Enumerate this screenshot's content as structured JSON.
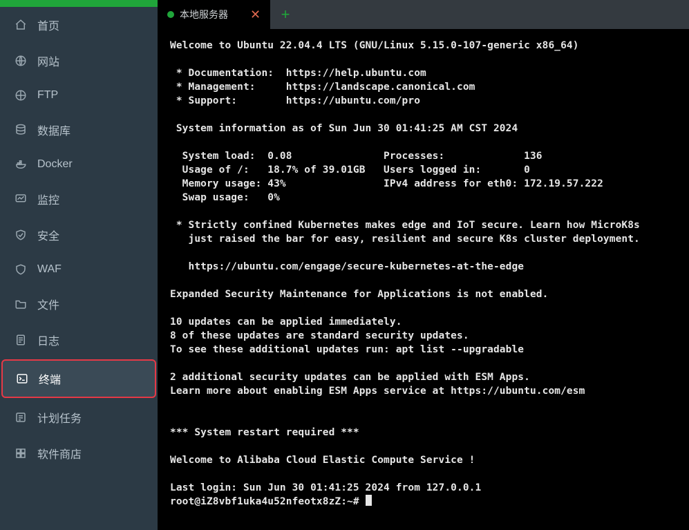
{
  "sidebar": {
    "items": [
      {
        "label": "首页",
        "name": "sidebar-item-home"
      },
      {
        "label": "网站",
        "name": "sidebar-item-site"
      },
      {
        "label": "FTP",
        "name": "sidebar-item-ftp"
      },
      {
        "label": "数据库",
        "name": "sidebar-item-database"
      },
      {
        "label": "Docker",
        "name": "sidebar-item-docker"
      },
      {
        "label": "监控",
        "name": "sidebar-item-monitor"
      },
      {
        "label": "安全",
        "name": "sidebar-item-security"
      },
      {
        "label": "WAF",
        "name": "sidebar-item-waf"
      },
      {
        "label": "文件",
        "name": "sidebar-item-files"
      },
      {
        "label": "日志",
        "name": "sidebar-item-logs"
      },
      {
        "label": "终端",
        "name": "sidebar-item-terminal"
      },
      {
        "label": "计划任务",
        "name": "sidebar-item-cron"
      },
      {
        "label": "软件商店",
        "name": "sidebar-item-softstore"
      }
    ]
  },
  "tabs": {
    "items": [
      {
        "label": "本地服务器"
      }
    ],
    "close_glyph": "✕",
    "add_glyph": "+"
  },
  "terminal": {
    "welcome": "Welcome to Ubuntu 22.04.4 LTS (GNU/Linux 5.15.0-107-generic x86_64)",
    "doc_line": " * Documentation:  https://help.ubuntu.com",
    "manage_line": " * Management:     https://landscape.canonical.com",
    "support_line": " * Support:        https://ubuntu.com/pro",
    "sysinfo_head": " System information as of Sun Jun 30 01:41:25 AM CST 2024",
    "sys_l1": "  System load:  0.08               Processes:             136",
    "sys_l2": "  Usage of /:   18.7% of 39.01GB   Users logged in:       0",
    "sys_l3": "  Memory usage: 43%                IPv4 address for eth0: 172.19.57.222",
    "sys_l4": "  Swap usage:   0%",
    "k8s_l1": " * Strictly confined Kubernetes makes edge and IoT secure. Learn how MicroK8s",
    "k8s_l2": "   just raised the bar for easy, resilient and secure K8s cluster deployment.",
    "k8s_link": "   https://ubuntu.com/engage/secure-kubernetes-at-the-edge",
    "esm_head": "Expanded Security Maintenance for Applications is not enabled.",
    "upd_l1": "10 updates can be applied immediately.",
    "upd_l2": "8 of these updates are standard security updates.",
    "upd_l3": "To see these additional updates run: apt list --upgradable",
    "esm_l1": "2 additional security updates can be applied with ESM Apps.",
    "esm_l2": "Learn more about enabling ESM Apps service at https://ubuntu.com/esm",
    "restart": "*** System restart required ***",
    "aliyun": "Welcome to Alibaba Cloud Elastic Compute Service !",
    "last_login": "Last login: Sun Jun 30 01:41:25 2024 from 127.0.0.1",
    "prompt": "root@iZ8vbf1uka4u52nfeotx8zZ:~# "
  }
}
